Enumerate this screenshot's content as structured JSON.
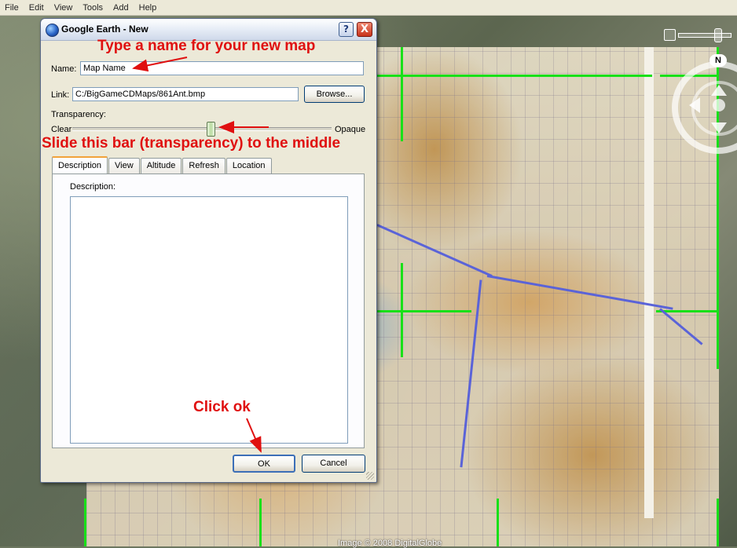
{
  "menu": {
    "items": [
      "File",
      "Edit",
      "View",
      "Tools",
      "Add",
      "Help"
    ]
  },
  "map": {
    "credit": "Image © 2008 DigitalGlobe",
    "compass_label": "N"
  },
  "dialog": {
    "title": "Google Earth - New",
    "help_label": "?",
    "close_label": "X",
    "name_label": "Name:",
    "name_value": "Map Name",
    "link_label": "Link:",
    "link_value": "C:/BigGameCDMaps/861Ant.bmp",
    "browse_label": "Browse...",
    "transparency_label": "Transparency:",
    "transparency_min": "Clear",
    "transparency_max": "Opaque",
    "transparency_value": 0.5,
    "tabs": [
      "Description",
      "View",
      "Altitude",
      "Refresh",
      "Location"
    ],
    "active_tab": "Description",
    "description_label": "Description:",
    "description_value": "",
    "ok_label": "OK",
    "cancel_label": "Cancel"
  },
  "annotations": {
    "name_hint": "Type a name for your new map",
    "slider_hint": "Slide this bar (transparency) to the middle",
    "ok_hint": "Click ok"
  },
  "colors": {
    "annotation": "#e01010",
    "grid": "#18e018",
    "river": "#5a63d8"
  },
  "icons": [
    "google-earth-logo-icon",
    "help-icon",
    "close-icon",
    "zoom-slider-icon",
    "compass-icon"
  ]
}
